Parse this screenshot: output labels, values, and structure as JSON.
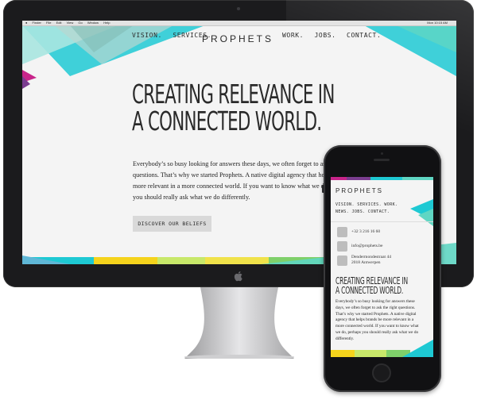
{
  "menubar": {
    "items": [
      "Finder",
      "File",
      "Edit",
      "View",
      "Go",
      "Window",
      "Help"
    ],
    "clock": "Mon 10:15 AM"
  },
  "desktop_site": {
    "nav_left": [
      "VISION.",
      "SERVICES."
    ],
    "logo": "PROPHETS",
    "nav_right": [
      "WORK.",
      "JOBS.",
      "CONTACT."
    ],
    "headline_line1": "CREATING RELEVANCE IN",
    "headline_line2": "A CONNECTED WORLD.",
    "body_lines": [
      "Everybody’s so busy looking for answers these days, we often forget to ask the right",
      "questions. That’s why we started Prophets. A native digital agency that helps brands be",
      "more relevant in a more connected world. If you want to know what we do, perhaps",
      "you should really ask what we do differently."
    ],
    "cta": "DISCOVER OUR BELIEFS"
  },
  "mobile_site": {
    "logo": "PROPHETS",
    "nav_row1": "VISION.  SERVICES.  WORK.",
    "nav_row2": "NEWS.  JOBS.  CONTACT.",
    "contact": {
      "phone": "+32 3 216 16 60",
      "email": "info@prophets.be",
      "address_line1": "Dendermondestraat 44",
      "address_line2": "2018 Antwerpen"
    },
    "headline_line1": "CREATING RELEVANCE IN",
    "headline_line2": "A CONNECTED WORLD.",
    "body_lines": [
      "Everybody’s so busy looking for answers these",
      "days, we often forget to ask the right questions.",
      "That’s why we started Prophets. A native digital",
      "agency that helps brands be more relevant in a",
      "more connected world. If you want to know what",
      "we do, perhaps you should really ask what we do",
      "differently."
    ]
  },
  "colors": {
    "cyan": "#1ec9d3",
    "teal": "#5fd6c3",
    "magenta": "#c8248a",
    "yellow": "#f5d31c",
    "green": "#7fd06a",
    "purple": "#7a3d8f",
    "pink": "#e84a8a"
  }
}
